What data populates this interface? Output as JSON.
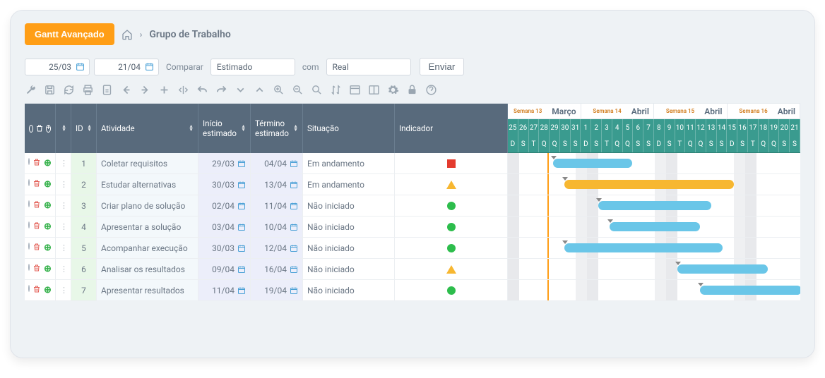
{
  "header": {
    "button": "Gantt Avançado",
    "breadcrumb": "Grupo de Trabalho"
  },
  "filters": {
    "from": "25/03",
    "to": "21/04",
    "compare_label": "Comparar",
    "compare_a": "Estimado",
    "with_label": "com",
    "compare_b": "Real",
    "send": "Enviar"
  },
  "columns": {
    "id": "ID",
    "activity": "Atividade",
    "start": "Início estimado",
    "end": "Término estimado",
    "status": "Situação",
    "indicator": "Indicador"
  },
  "rows": [
    {
      "id": "1",
      "act": "Coletar requisitos",
      "ini": "29/03",
      "fim": "04/04",
      "sit": "Em andamento",
      "ind": "square",
      "startIdx": 4,
      "endIdx": 10,
      "color": "blue",
      "warnIdx": 4
    },
    {
      "id": "2",
      "act": "Estudar alternativas",
      "ini": "30/03",
      "fim": "13/04",
      "sit": "Em andamento",
      "ind": "triangle",
      "startIdx": 5,
      "endIdx": 19,
      "color": "yellow",
      "warnIdx": 5
    },
    {
      "id": "3",
      "act": "Criar plano de solução",
      "ini": "02/04",
      "fim": "11/04",
      "sit": "Não iniciado",
      "ind": "circle",
      "startIdx": 8,
      "endIdx": 17,
      "color": "blue",
      "warnIdx": 8
    },
    {
      "id": "4",
      "act": "Apresentar a solução",
      "ini": "03/04",
      "fim": "10/04",
      "sit": "Não iniciado",
      "ind": "circle",
      "startIdx": 9,
      "endIdx": 16,
      "color": "blue",
      "warnIdx": 9
    },
    {
      "id": "5",
      "act": "Acompanhar execução",
      "ini": "30/03",
      "fim": "12/04",
      "sit": "Não iniciado",
      "ind": "circle",
      "startIdx": 5,
      "endIdx": 18,
      "color": "blue",
      "warnIdx": 5
    },
    {
      "id": "6",
      "act": "Analisar os resultados",
      "ini": "09/04",
      "fim": "16/04",
      "sit": "Não iniciado",
      "ind": "triangle",
      "startIdx": 15,
      "endIdx": 22,
      "color": "blue",
      "warnIdx": 15
    },
    {
      "id": "7",
      "act": "Apresentar resultados",
      "ini": "11/04",
      "fim": "19/04",
      "sit": "Não iniciado",
      "ind": "circle",
      "startIdx": 17,
      "endIdx": 25,
      "color": "blue",
      "warnIdx": 17
    }
  ],
  "timeline": {
    "months": [
      {
        "label": "Março",
        "tag": "Semana 13",
        "span": 7
      },
      {
        "label": "Abril",
        "tag": "Semana 14",
        "span": 7
      },
      {
        "label": "Abril",
        "tag": "Semana 15",
        "span": 7
      },
      {
        "label": "Abril",
        "tag": "Semana 16",
        "span": 7
      }
    ],
    "days": [
      "25",
      "26",
      "27",
      "28",
      "29",
      "30",
      "31",
      "1",
      "2",
      "3",
      "4",
      "5",
      "6",
      "7",
      "8",
      "9",
      "10",
      "11",
      "12",
      "13",
      "14",
      "15",
      "16",
      "17",
      "18",
      "19",
      "20",
      "21"
    ],
    "wdays": [
      "D",
      "S",
      "T",
      "Q",
      "Q",
      "S",
      "S",
      "D",
      "S",
      "T",
      "Q",
      "Q",
      "S",
      "S",
      "D",
      "S",
      "T",
      "Q",
      "Q",
      "S",
      "S",
      "D",
      "S",
      "T",
      "Q",
      "Q",
      "S",
      "S"
    ],
    "weekends": [
      0,
      7,
      14,
      21
    ],
    "todayIdx": 3
  }
}
